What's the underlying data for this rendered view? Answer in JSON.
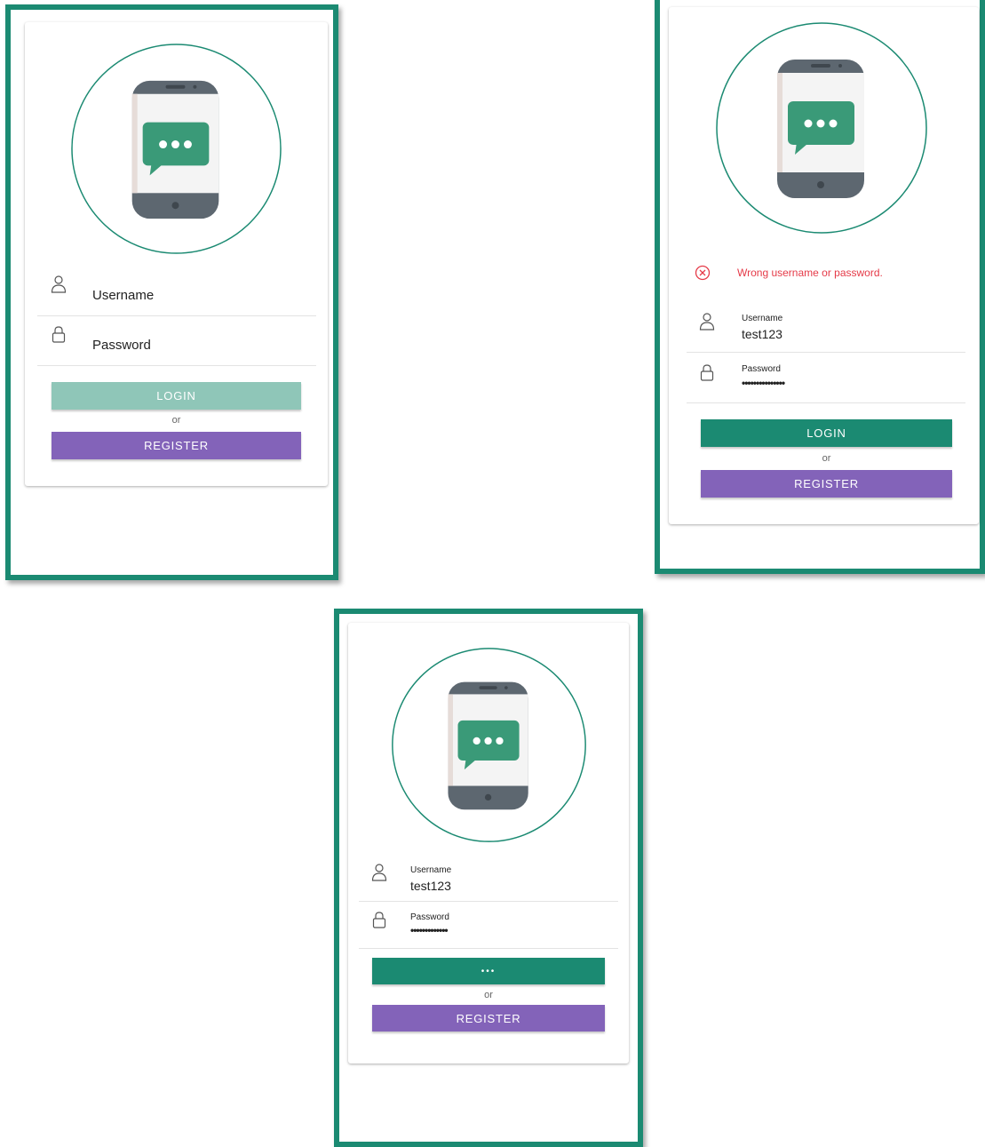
{
  "colors": {
    "frame": "#1b8a72",
    "primary": "#1b8a72",
    "primary_disabled": "#8fc6b8",
    "register": "#8363b9",
    "error": "#e53a48",
    "bubble": "#3a9a78",
    "phone_body": "#5d6770"
  },
  "logo_icon": "chat-phone-icon",
  "screens": [
    {
      "state": "empty",
      "username": {
        "label": "Username",
        "icon": "user-icon"
      },
      "password": {
        "label": "Password",
        "icon": "lock-icon"
      },
      "login_label": "LOGIN",
      "or_label": "or",
      "register_label": "REGISTER"
    },
    {
      "state": "error",
      "error": {
        "icon": "error-circle-icon",
        "text": "Wrong username or password."
      },
      "username": {
        "label": "Username",
        "value": "test123",
        "icon": "user-icon"
      },
      "password": {
        "label": "Password",
        "masked": "•••••••••••••••",
        "icon": "lock-icon"
      },
      "login_label": "LOGIN",
      "or_label": "or",
      "register_label": "REGISTER"
    },
    {
      "state": "loading",
      "username": {
        "label": "Username",
        "value": "test123",
        "icon": "user-icon"
      },
      "password": {
        "label": "Password",
        "masked": "•••••••••••••",
        "icon": "lock-icon"
      },
      "login_label": "•••",
      "or_label": "or",
      "register_label": "REGISTER"
    }
  ]
}
